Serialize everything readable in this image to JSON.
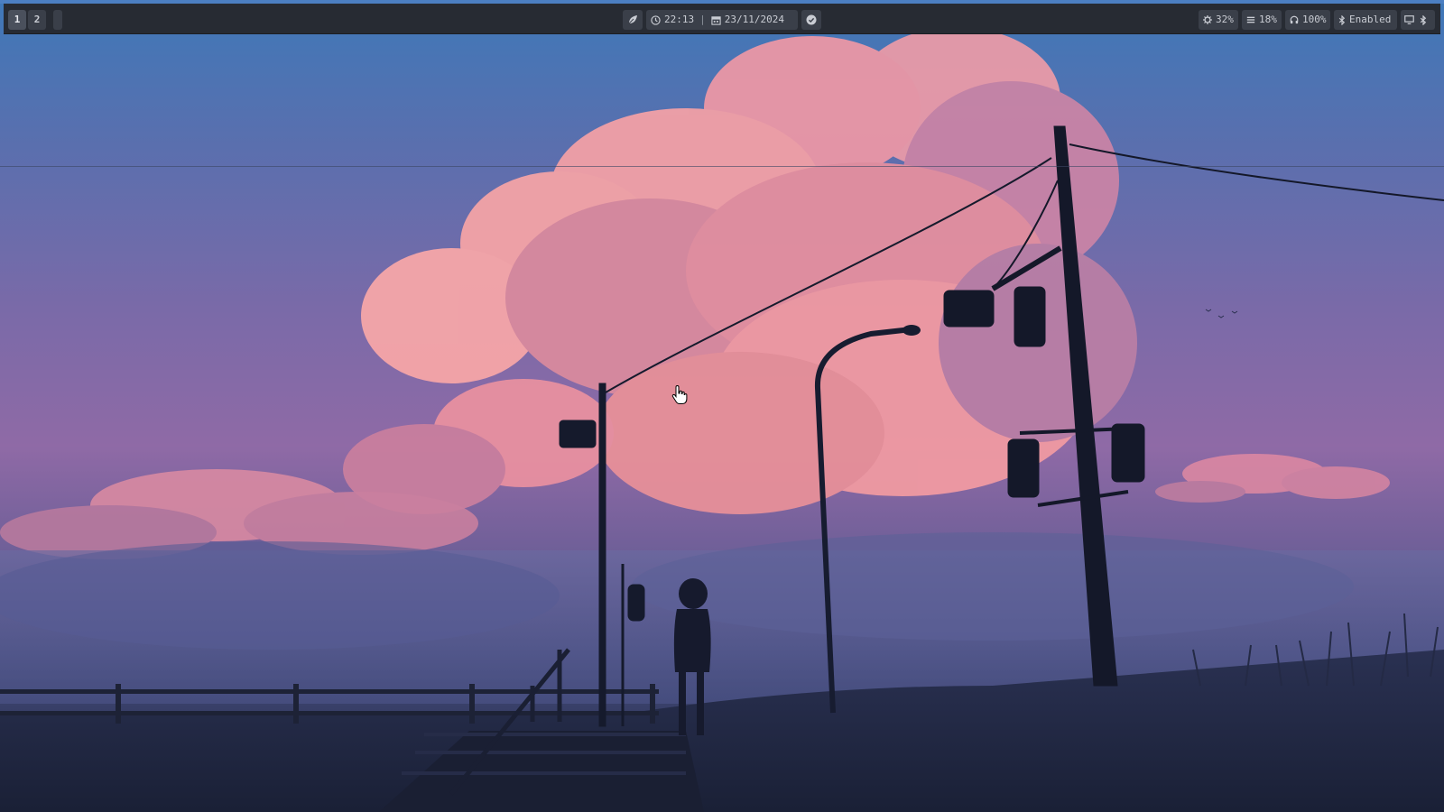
{
  "topbar": {
    "workspaces": [
      {
        "label": "1",
        "active": true
      },
      {
        "label": "2",
        "active": false
      }
    ],
    "launcher_icon": "leaf-icon",
    "clock": {
      "icon": "clock-icon",
      "time": "22:13",
      "separator": "|"
    },
    "date": {
      "icon": "calendar-icon",
      "value": "23/11/2024"
    },
    "status_icon": "check-circle-icon",
    "cpu": {
      "icon": "cpu-icon",
      "value": "32%"
    },
    "memory": {
      "icon": "memory-icon",
      "value": "18%"
    },
    "volume": {
      "icon": "headphones-icon",
      "value": "100%"
    },
    "bluetooth_status": {
      "icon": "bluetooth-icon",
      "value": "Enabled"
    },
    "tray": [
      {
        "icon": "monitor-icon"
      },
      {
        "icon": "bluetooth-icon"
      }
    ]
  },
  "colors": {
    "bar_bg": "#272b33",
    "chip_bg": "#3a3f49",
    "text": "#c9ccd3",
    "accent_line": "#4c7fc2"
  },
  "wallpaper": {
    "description_icon": "wallpaper-image"
  }
}
